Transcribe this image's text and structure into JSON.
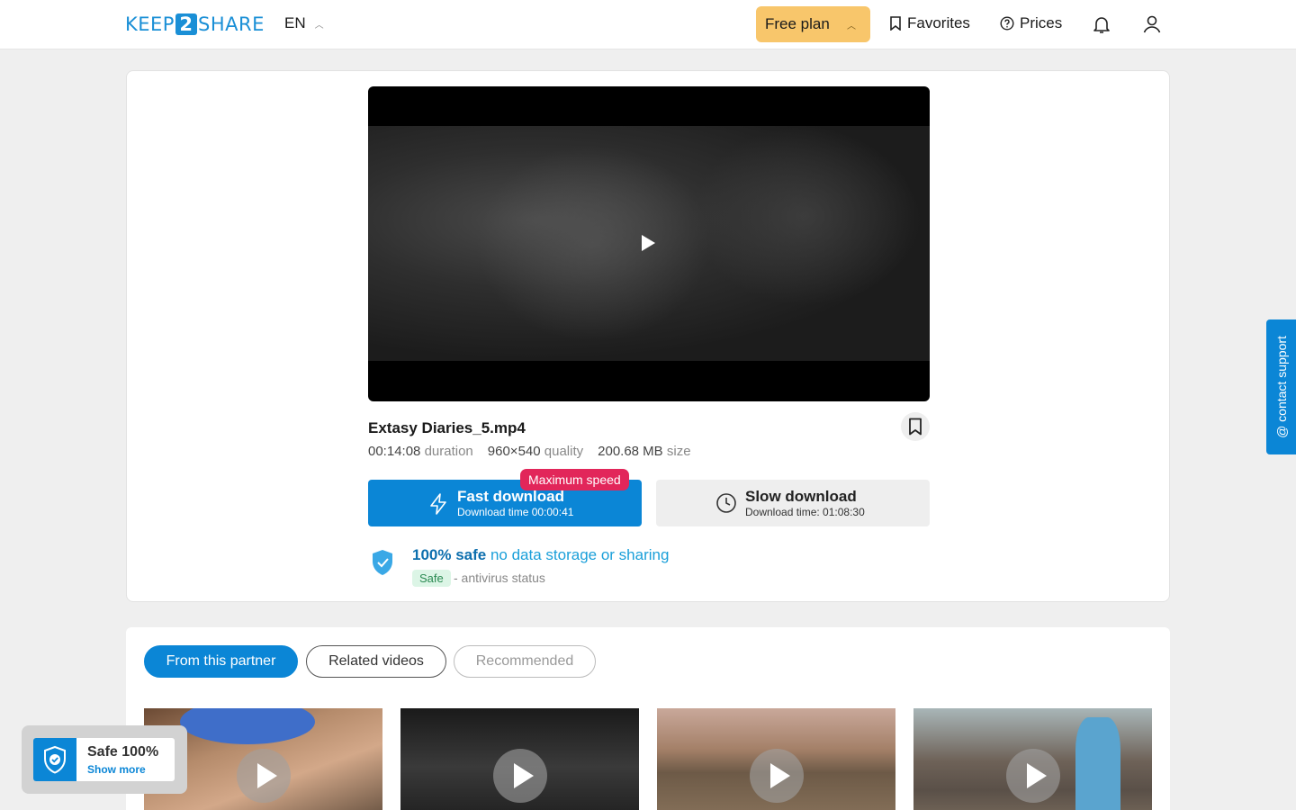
{
  "header": {
    "logo_left": "KEEP",
    "logo_mid": "2",
    "logo_right": "SHARE",
    "lang": "EN",
    "plan": "Free plan",
    "favorites": "Favorites",
    "prices": "Prices"
  },
  "file": {
    "name": "Extasy Diaries_5.mp4",
    "duration": "00:14:08",
    "duration_label": "duration",
    "quality": "960×540",
    "quality_label": "quality",
    "size": "200.68 MB",
    "size_label": "size"
  },
  "download": {
    "fast_title": "Fast download",
    "fast_time": "Download time 00:00:41",
    "badge": "Maximum speed",
    "slow_title": "Slow download",
    "slow_time": "Download time: 01:08:30"
  },
  "safety": {
    "strong": "100% safe",
    "text": " no data storage or sharing",
    "badge": "Safe",
    "status": "- antivirus status"
  },
  "tabs": [
    "From this partner",
    "Related videos",
    "Recommended"
  ],
  "support": "@ contact support",
  "widget": {
    "title": "Safe 100%",
    "link": "Show more"
  },
  "colors": {
    "accent": "#0b86d6",
    "plan": "#f8c66b",
    "badge": "#e2265a"
  }
}
